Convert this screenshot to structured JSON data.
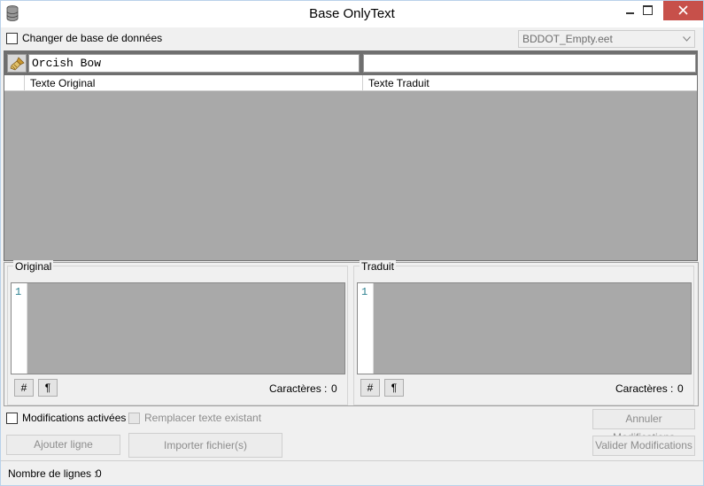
{
  "window": {
    "title": "Base OnlyText",
    "icon": "database-icon"
  },
  "top": {
    "change_db_label": "Changer de base de données",
    "change_db_checked": false,
    "db_select_value": "BDDOT_Empty.eet"
  },
  "grid": {
    "filter_original_value": "Orcish Bow",
    "filter_translated_value": "",
    "columns": [
      "Texte Original",
      "Texte Traduit"
    ],
    "rows": []
  },
  "original": {
    "title": "Original",
    "line_number": "1",
    "hash_button": "#",
    "pilcrow_button": "¶",
    "chars_label": "Caractères :",
    "chars_count": "0"
  },
  "translated": {
    "title": "Traduit",
    "line_number": "1",
    "hash_button": "#",
    "pilcrow_button": "¶",
    "chars_label": "Caractères :",
    "chars_count": "0"
  },
  "controls": {
    "modifications_label": "Modifications activées",
    "modifications_checked": false,
    "replace_label": "Remplacer texte existant",
    "replace_checked": false,
    "cancel_button": "Annuler Modifications",
    "validate_button": "Valider Modifications",
    "add_line_button": "Ajouter ligne",
    "import_button": "Importer fichier(s)"
  },
  "status": {
    "line_count_label": "Nombre de lignes :",
    "line_count": "0"
  }
}
